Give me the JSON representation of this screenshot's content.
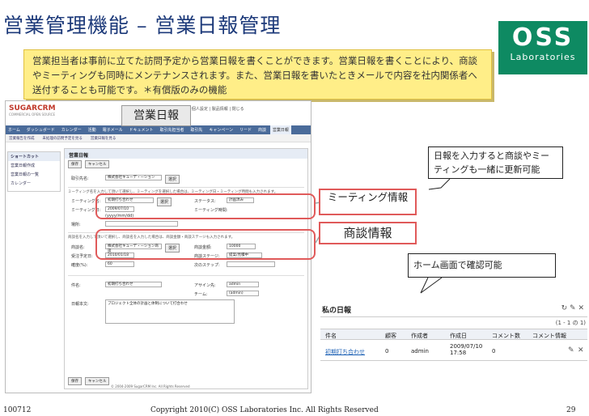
{
  "slide": {
    "title": "営業管理機能 – 営業日報管理",
    "callout": "営業担当者は事前に立てた訪問予定から営業日報を書くことができます。営業日報を書くことにより、商談やミーティングも同時にメンテナンスされます。また、営業日報を書いたときメールで内容を社内関係者へ送付することも可能です。＊有償版のみの機能",
    "logo_big": "OSS",
    "logo_small": "Laboratories",
    "label_nippo": "営業日報",
    "label_meeting": "ミーティング情報",
    "label_opportunity": "商談情報",
    "bubble_update": "日報を入力すると商談やミーティングも一緒に更新可能",
    "bubble_home": "ホーム画面で確認可能",
    "footer_left": "100712",
    "footer_center": "Copyright 2010(C) OSS Laboratories Inc. All Rights Reserved",
    "footer_right": "29",
    "accent": "#e05a5a"
  },
  "screenshot": {
    "brand": "SUGARCRM",
    "brand_tag": "COMMERCIAL OPEN SOURCE",
    "top_links": "管理者 | 個人設定 | 製品情報 | 閉じる",
    "nav": [
      "ホーム",
      "ダッシュボード",
      "カレンダー",
      "活動",
      "電子メール",
      "ドキュメント",
      "取引先担当者",
      "取引先",
      "キャンペーン",
      "リード",
      "商談",
      "営業日報"
    ],
    "nav_active": "営業日報",
    "shortcuts": [
      "営業報告を作成",
      "未処理の訪問予定を見る",
      "営業日報を見る"
    ],
    "side_header": "ショートカット",
    "side_items": [
      "営業日報作成",
      "営業日報の一覧",
      "カレンダー"
    ],
    "form_header": "営業日報",
    "save": "保存",
    "cancel": "キャンセル",
    "fields": {
      "account_label": "取引先名:",
      "account_value": "株式会社キューデ・ーション",
      "select": "選択",
      "meeting_note": "ミーティング名を入力して頂いて選択し、ミーティングを選択した場合は、ミーティング日・ミーティング時間も入力されます。",
      "meeting_name_label": "ミーティング名:",
      "meeting_name_value": "初期打ち合わせ",
      "meeting_date_label": "ミーティング日:",
      "meeting_date_value": "2009/07/10",
      "status_label": "ステータス:",
      "status_value": "計画済み",
      "meeting_time_label": "ミーティング時間:",
      "date_fmt": "(yyyy/mm/dd)",
      "place_label": "場所:",
      "opp_note": "商談名を入力して頂いて選択し、商談名を入力した場合は、商談金額・商談ステージも入力されます。",
      "opp_name_label": "商談名:",
      "opp_name_value": "株式会社キューデ・ーション商談",
      "opp_amount_label": "商談金額:",
      "opp_amount_value": "10000",
      "close_date_label": "受注予定日:",
      "close_date_value": "2010/01/18",
      "stage_label": "商談ステージ:",
      "stage_value": "提案/見積中",
      "prob_label": "確度(%):",
      "prob_value": "60",
      "next_step_label": "次のステップ:",
      "subject_label": "件名:",
      "subject_value": "初期打ち合わせ",
      "assigned_label": "アサイン先:",
      "assigned_value": "admin",
      "team_label": "チーム:",
      "team_value": "(admin)",
      "content_label": "日報本文:",
      "content_value": "プロジェクト全体の計画と体制について打合わせ"
    },
    "footer": "© 2004-2009 SugarCRM Inc. All Rights Reserved"
  },
  "dashlet": {
    "title": "私の日報",
    "icons": "↻ ✎ ✕",
    "pager": "(1 - 1 の 1)",
    "columns": [
      "件名",
      "顧客",
      "作成者",
      "作成日",
      "コメント数",
      "コメント情報"
    ],
    "row": {
      "subject": "初期打ち合わせ",
      "client": "0",
      "author": "admin",
      "date": "2009/07/10 17:58",
      "comments": "0"
    }
  }
}
